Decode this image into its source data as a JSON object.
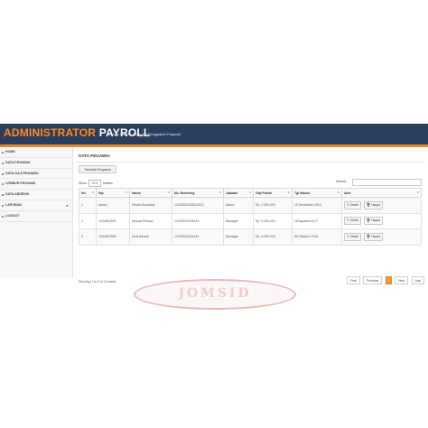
{
  "header": {
    "title_part1": "ADMINISTRATOR",
    "title_part2": "PAYROLL",
    "tagline": "Aplikasi Sistem Informasi Penggajian Pegawai",
    "accent_color": "#e08a2b",
    "bar_color": "#2b3e5c"
  },
  "sidebar": {
    "items": [
      {
        "label": "HOME"
      },
      {
        "label": "DATA PEGAWAI"
      },
      {
        "label": "DATA GAJI PEGAWAI"
      },
      {
        "label": "LEMBUR PEGAWAI"
      },
      {
        "label": "DATA ABSENSI"
      },
      {
        "label": "LAPORAN",
        "caret": "◄"
      },
      {
        "label": "LOGOUT"
      }
    ]
  },
  "main": {
    "page_title": "DATA PEGAWAI",
    "add_button": "Tambah Pegawai",
    "show_label": "Show",
    "entries_value": "10",
    "entries_label": "entries",
    "search_label": "Search:",
    "table": {
      "headers": [
        "No.",
        "Nip",
        "Nama",
        "No. Rekening",
        "Jabatan",
        "Gaji Pokok",
        "Tgl Masuk",
        "Aksi"
      ],
      "rows": [
        [
          "1",
          "admin",
          "Devita Sravilana",
          "12325020235321521",
          "Admin",
          "Rp. 2.500.000",
          "10 November 2013"
        ],
        [
          "2",
          "1234567891",
          "Ahmad Ridwan",
          "12325032424424",
          "Manager",
          "Rp. 5.000.000",
          "18 Agustus 2017"
        ],
        [
          "3",
          "1234567890",
          "Dedi Ashadi",
          "12325032424424",
          "Manager",
          "Rp. 5.000.000",
          "08 Oktober 2018"
        ]
      ],
      "action_detail": "Detail",
      "action_delete": "Hapus"
    },
    "info": "Showing 1 to 3 of 3 entries",
    "pagination": {
      "first": "First",
      "previous": "Previous",
      "current": "1",
      "next": "Next",
      "last": "Last"
    }
  },
  "watermark": "JOMSID"
}
